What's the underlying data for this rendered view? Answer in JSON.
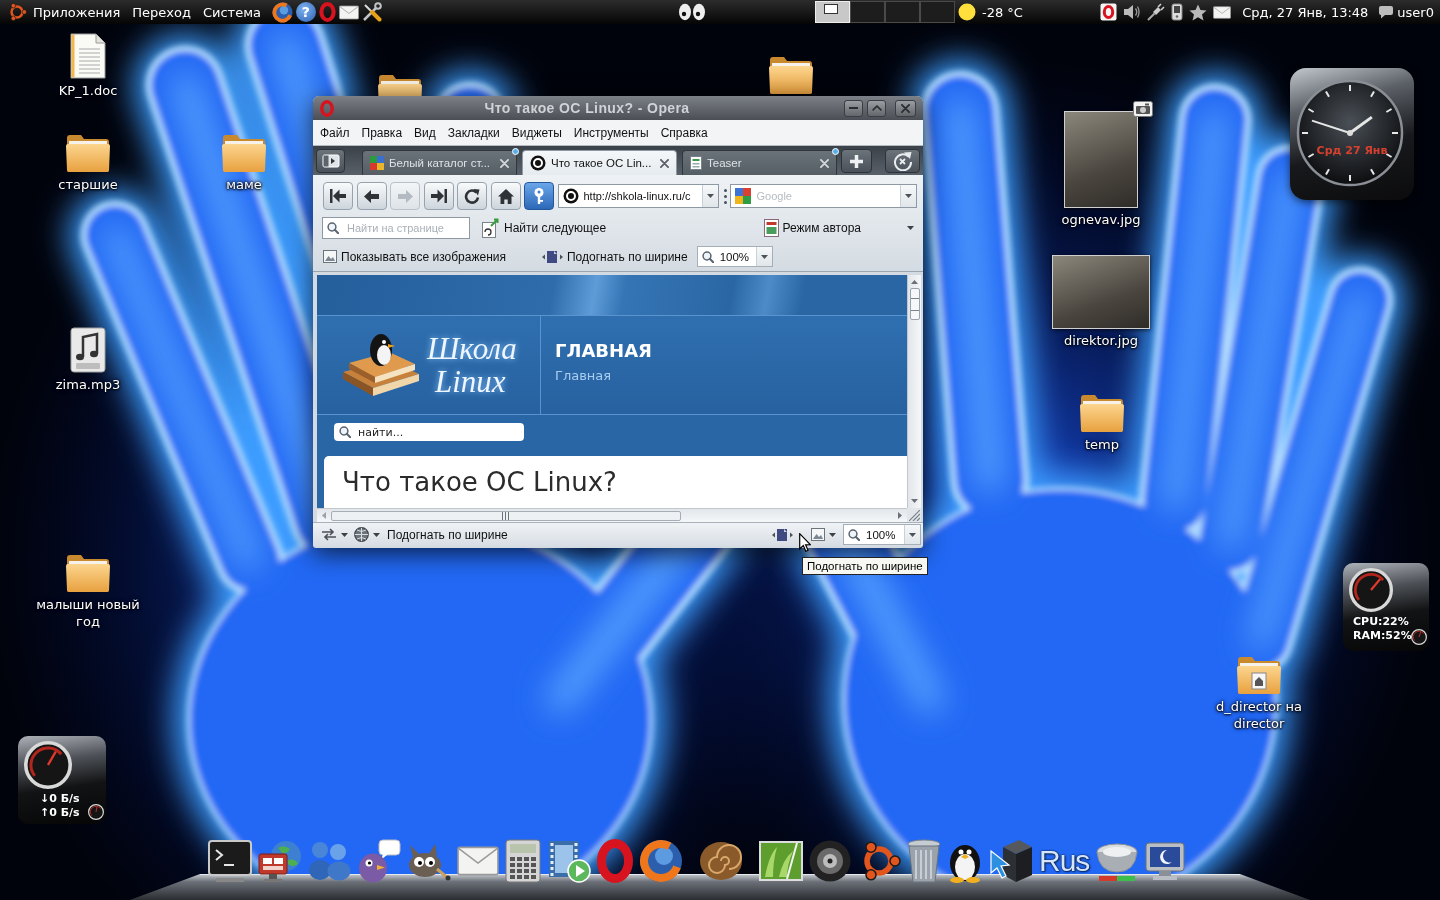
{
  "top_panel": {
    "menus": [
      "Приложения",
      "Переход",
      "Система"
    ],
    "help_symbol": "?",
    "workspaces": [
      {
        "selected": true
      },
      {
        "selected": false
      },
      {
        "selected": false
      },
      {
        "selected": false
      }
    ],
    "weather": "-28 °C",
    "clock": "Срд, 27 Янв, 13:48",
    "user": "user0"
  },
  "desktop_icons": [
    {
      "label": "KP_1.doc",
      "kind": "document"
    },
    {
      "label": "старшие",
      "kind": "folder"
    },
    {
      "label": "маме",
      "kind": "folder"
    },
    {
      "label": "zima.mp3",
      "kind": "audio"
    },
    {
      "label": "малыши новый год",
      "kind": "folder"
    },
    {
      "label": "ognevav.jpg",
      "kind": "photo",
      "camera_badge": true
    },
    {
      "label": "direktor.jpg",
      "kind": "photo",
      "camera_badge": false
    },
    {
      "label": "temp",
      "kind": "folder"
    },
    {
      "label": "d_director на director",
      "kind": "share"
    }
  ],
  "widgets": {
    "clock_date": "Срд 27 Янв",
    "cpu": "CPU:22%",
    "ram": "RAM:52%",
    "download": "↓0 Б/s",
    "upload": "↑0 Б/s"
  },
  "browser": {
    "title": "Что такое ОС Linux? - Opera",
    "menu": [
      "Файл",
      "Правка",
      "Вид",
      "Закладки",
      "Виджеты",
      "Инструменты",
      "Справка"
    ],
    "tabs": [
      {
        "label": "Белый каталог ст...",
        "selected": false,
        "badge": true
      },
      {
        "label": "Что такое ОС Lin...",
        "selected": true,
        "badge": false
      },
      {
        "label": "Teaser",
        "selected": false,
        "badge": true
      }
    ],
    "forward_disabled": true,
    "address": "http://shkola-linux.ru/c",
    "search_placeholder": "Google",
    "find_placeholder": "Найти на странице",
    "find_next": "Найти следующее",
    "author_mode": "Режим автора",
    "show_images": "Показывать все изображения",
    "fit_width": "Подогнать по ширине",
    "zoom": "100%",
    "page": {
      "logo": [
        "Школа",
        "Linux"
      ],
      "heading": "ГЛАВНАЯ",
      "breadcrumb": "Главная",
      "search_placeholder": "найти...",
      "article_title": "Что такое ОС Linux?"
    },
    "status_bar": {
      "text": "Подогнать по ширине",
      "zoom": "100%"
    },
    "tooltip": "Подогнать по ширине"
  },
  "dock": {
    "layout_indicator": "Rus"
  }
}
